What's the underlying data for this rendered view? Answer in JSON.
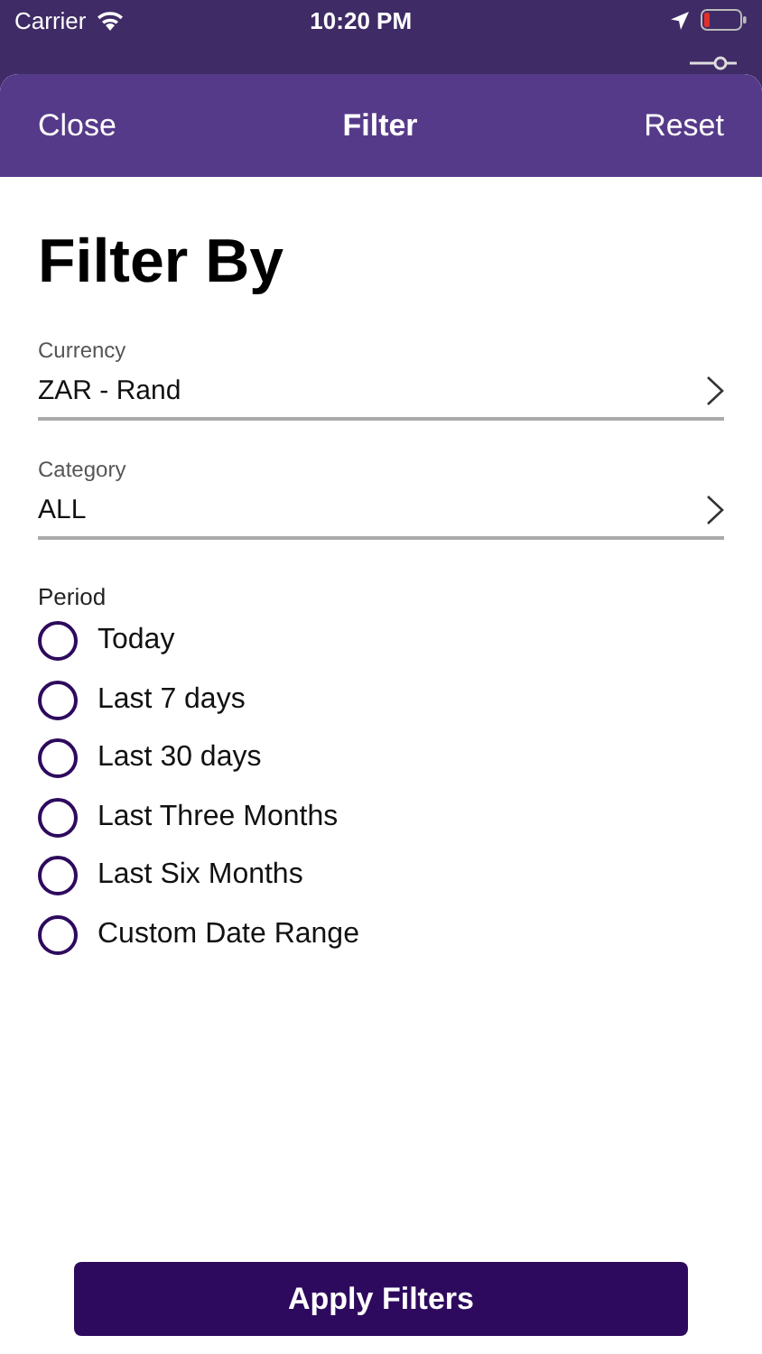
{
  "status_bar": {
    "carrier": "Carrier",
    "time": "10:20 PM"
  },
  "header": {
    "close": "Close",
    "title": "Filter",
    "reset": "Reset"
  },
  "heading": "Filter By",
  "fields": [
    {
      "label": "Currency",
      "value": "ZAR - Rand"
    },
    {
      "label": "Category",
      "value": "ALL"
    }
  ],
  "period": {
    "label": "Period",
    "options": [
      {
        "label": "Today",
        "selected": false
      },
      {
        "label": "Last 7 days",
        "selected": false
      },
      {
        "label": "Last 30 days",
        "selected": false
      },
      {
        "label": "Last Three Months",
        "selected": false
      },
      {
        "label": "Last Six Months",
        "selected": false
      },
      {
        "label": "Custom Date Range",
        "selected": false
      }
    ]
  },
  "apply_button": "Apply Filters"
}
